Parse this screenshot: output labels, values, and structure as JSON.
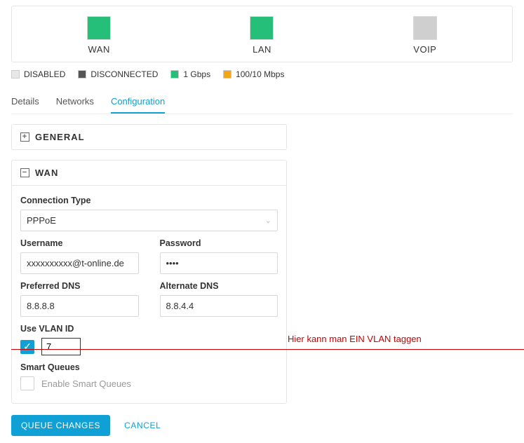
{
  "status": {
    "items": [
      {
        "label": "WAN",
        "color": "on"
      },
      {
        "label": "LAN",
        "color": "on"
      },
      {
        "label": "VOIP",
        "color": "off"
      }
    ]
  },
  "legend": {
    "disabled": "DISABLED",
    "disconnected": "DISCONNECTED",
    "gbps": "1 Gbps",
    "mbps": "100/10 Mbps"
  },
  "tabs": {
    "details": "Details",
    "networks": "Networks",
    "configuration": "Configuration"
  },
  "general": {
    "title": "GENERAL"
  },
  "wan": {
    "title": "WAN",
    "connection_type_label": "Connection Type",
    "connection_type_value": "PPPoE",
    "username_label": "Username",
    "username_value": "xxxxxxxxxx@t-online.de",
    "password_label": "Password",
    "password_value": "••••",
    "pref_dns_label": "Preferred DNS",
    "pref_dns_value": "8.8.8.8",
    "alt_dns_label": "Alternate DNS",
    "alt_dns_value": "8.8.4.4",
    "vlan_label": "Use VLAN ID",
    "vlan_checked": true,
    "vlan_value": "7",
    "smart_queues_label": "Smart Queues",
    "enable_smart_queues_label": "Enable Smart Queues"
  },
  "annotation": {
    "text": "Hier kann man EIN VLAN taggen"
  },
  "actions": {
    "queue": "QUEUE CHANGES",
    "cancel": "CANCEL"
  }
}
